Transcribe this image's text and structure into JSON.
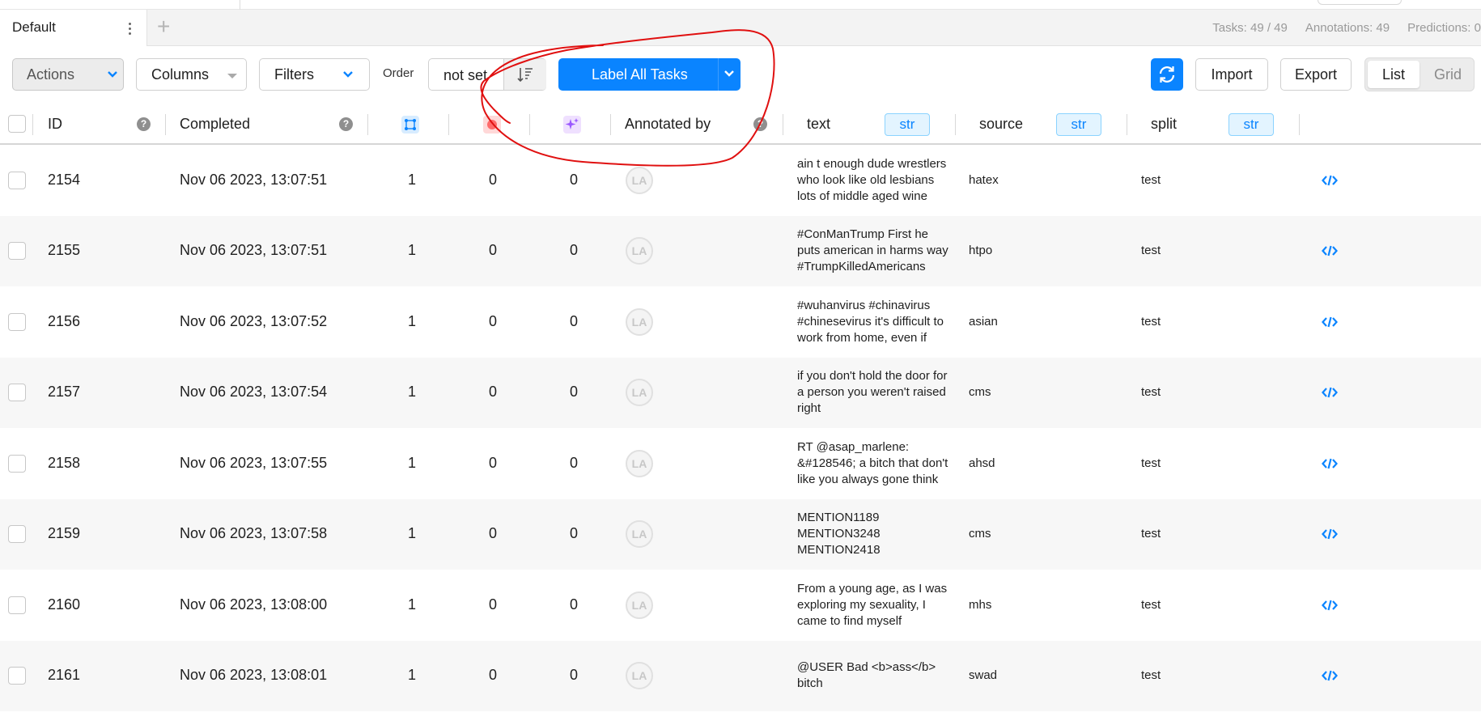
{
  "tabs": {
    "active_label": "Default",
    "add_label": "+"
  },
  "stats": {
    "tasks": "Tasks: 49 / 49",
    "annotations": "Annotations: 49",
    "predictions": "Predictions: 0"
  },
  "toolbar": {
    "actions_label": "Actions",
    "columns_label": "Columns",
    "filters_label": "Filters",
    "order_label": "Order",
    "order_value": "not set",
    "label_all_label": "Label All Tasks",
    "import_label": "Import",
    "export_label": "Export",
    "view_list": "List",
    "view_grid": "Grid"
  },
  "colors": {
    "accent": "#0a84ff",
    "annotation_stroke": "#e01010"
  },
  "table": {
    "headers": {
      "id": "ID",
      "completed": "Completed",
      "annotated_by": "Annotated by",
      "text": "text",
      "source": "source",
      "split": "split",
      "type_badge": "str"
    },
    "header_icons": [
      "annotations-count-icon",
      "cancelled-count-icon",
      "predictions-count-icon"
    ],
    "rows": [
      {
        "id": "2154",
        "completed": "Nov 06 2023, 13:07:51",
        "annotations": "1",
        "cancelled": "0",
        "predictions": "0",
        "annotator": "LA",
        "text": [
          "ain t enough dude wrestlers",
          "who look like old lesbians",
          "lots of middle aged wine"
        ],
        "source": "hatex",
        "split": "test"
      },
      {
        "id": "2155",
        "completed": "Nov 06 2023, 13:07:51",
        "annotations": "1",
        "cancelled": "0",
        "predictions": "0",
        "annotator": "LA",
        "text": [
          "#ConManTrump First he",
          "puts american in harms way",
          "#TrumpKilledAmericans"
        ],
        "source": "htpo",
        "split": "test"
      },
      {
        "id": "2156",
        "completed": "Nov 06 2023, 13:07:52",
        "annotations": "1",
        "cancelled": "0",
        "predictions": "0",
        "annotator": "LA",
        "text": [
          "#wuhanvirus #chinavirus",
          "#chinesevirus it's difficult to",
          "work from home, even if"
        ],
        "source": "asian",
        "split": "test"
      },
      {
        "id": "2157",
        "completed": "Nov 06 2023, 13:07:54",
        "annotations": "1",
        "cancelled": "0",
        "predictions": "0",
        "annotator": "LA",
        "text": [
          "if you don't hold the door for",
          "a person you weren't raised",
          "right"
        ],
        "source": "cms",
        "split": "test"
      },
      {
        "id": "2158",
        "completed": "Nov 06 2023, 13:07:55",
        "annotations": "1",
        "cancelled": "0",
        "predictions": "0",
        "annotator": "LA",
        "text": [
          "RT @asap_marlene:",
          "&#128546; a bitch that don't",
          "like you always gone think"
        ],
        "source": "ahsd",
        "split": "test"
      },
      {
        "id": "2159",
        "completed": "Nov 06 2023, 13:07:58",
        "annotations": "1",
        "cancelled": "0",
        "predictions": "0",
        "annotator": "LA",
        "text": [
          "MENTION1189",
          "MENTION3248",
          "MENTION2418"
        ],
        "source": "cms",
        "split": "test"
      },
      {
        "id": "2160",
        "completed": "Nov 06 2023, 13:08:00",
        "annotations": "1",
        "cancelled": "0",
        "predictions": "0",
        "annotator": "LA",
        "text": [
          "From a young age, as I was",
          "exploring my sexuality, I",
          "came to find myself"
        ],
        "source": "mhs",
        "split": "test"
      },
      {
        "id": "2161",
        "completed": "Nov 06 2023, 13:08:01",
        "annotations": "1",
        "cancelled": "0",
        "predictions": "0",
        "annotator": "LA",
        "text": [
          "@USER Bad <b>ass</b>",
          "bitch"
        ],
        "source": "swad",
        "split": "test"
      }
    ]
  }
}
